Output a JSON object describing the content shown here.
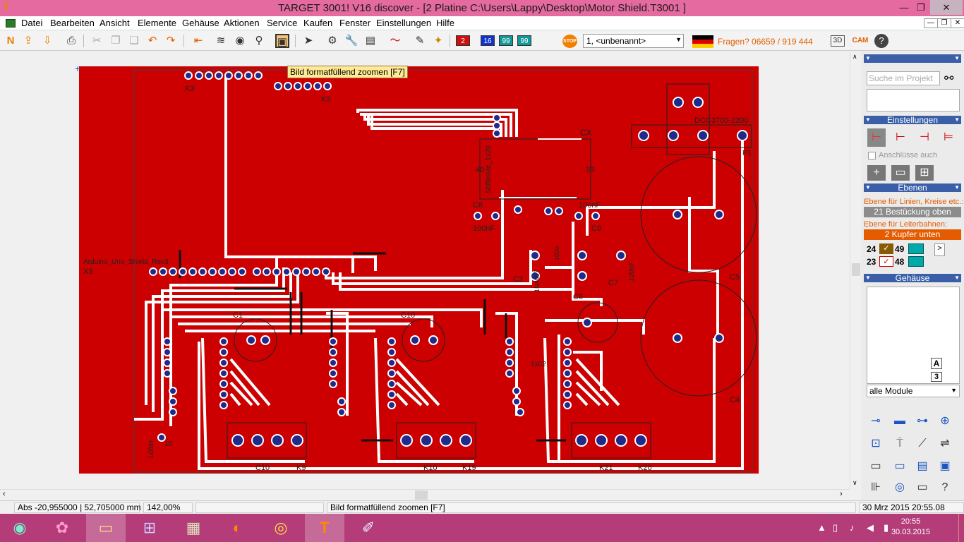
{
  "window": {
    "title": "TARGET 3001! V16 discover - [2 Platine C:\\Users\\Lappy\\Desktop\\Motor Shield.T3001 ]",
    "app_icon": "T",
    "min_glyph": "—",
    "max_glyph": "❐",
    "close_glyph": "✕"
  },
  "menu": {
    "items": [
      "Datei",
      "Bearbeiten",
      "Ansicht",
      "Elemente",
      "Gehäuse",
      "Aktionen",
      "Service",
      "Kaufen",
      "Fenster",
      "Einstellungen",
      "Hilfe"
    ],
    "mdi_min": "—",
    "mdi_restore": "❐",
    "mdi_close": "✕"
  },
  "toolbar": {
    "layer_buttons": [
      "2",
      "16",
      "99",
      "99"
    ],
    "stop_label": "STOP",
    "layer_combo": "1, <unbenannt>",
    "fragen": "Fragen? 06659 / 919 444",
    "cam_label": "CAM",
    "threed_label": "3D",
    "help_glyph": "?"
  },
  "tooltip": "Bild formatfüllend zoomen [F7]",
  "board": {
    "labels": [
      "K3",
      "K3",
      "CX",
      "40",
      "39",
      "Stiftleiste_1x20",
      "C8",
      "100nF",
      "C9",
      "100nF",
      "C6",
      "C5",
      "C4",
      "C1",
      "C10",
      "C10",
      "X3",
      "Arduino_Uno_Shield_Rev3",
      "K9",
      "K10",
      "K19",
      "K21",
      "K20",
      "C3",
      "C7",
      "100nF",
      "1x02",
      "Lüfter",
      "10",
      "DCC3700-2200",
      "P1",
      "1N4007",
      "100u"
    ],
    "colors": {
      "copper": "#cc0000",
      "track": "#ffffff",
      "pad": "#1f2a8a",
      "silk": "#2a2a2a"
    }
  },
  "panel": {
    "search_placeholder": "Suche im Projekt",
    "einstellungen": "Einstellungen",
    "anschluesse": "Anschlüsse auch",
    "ebenen": "Ebenen",
    "ebene_linien_label": "Ebene für Linien, Kreise etc.:",
    "ebene_linien_value": "21 Bestückung oben",
    "ebene_leiter_label": "Ebene für Leiterbahnen:",
    "ebene_leiter_value": "2 Kupfer unten",
    "layer_numbers": [
      "24",
      "49",
      "23",
      "48"
    ],
    "gehaeuse": "Gehäuse",
    "module_select": "alle Module",
    "a_button": "A",
    "three_button": "3"
  },
  "status": {
    "coords": "Abs -20,955000 | 52,705000 mm",
    "zoom": "142,00%",
    "empty": "",
    "message": "Bild formatfüllend zoomen [F7]",
    "datetime": "30 Mrz 2015 20:55.08"
  },
  "taskbar": {
    "time": "20:55",
    "date": "30.03.2015"
  }
}
